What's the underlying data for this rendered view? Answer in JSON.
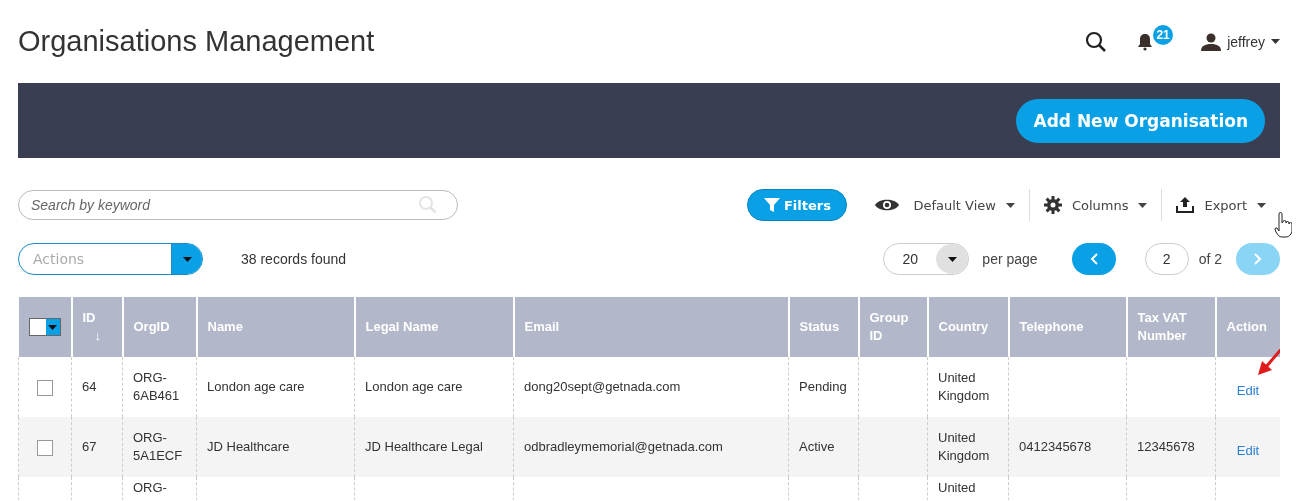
{
  "header": {
    "title": "Organisations Management",
    "notifications": "21",
    "user": "jeffrey"
  },
  "banner": {
    "button": "Add New Organisation"
  },
  "search": {
    "placeholder": "Search by keyword"
  },
  "toolbar": {
    "filters": "Filters",
    "view": "Default View",
    "columns": "Columns",
    "export": "Export"
  },
  "actions": {
    "placeholder": "Actions"
  },
  "records": "38 records found",
  "pagination": {
    "per_page_value": "20",
    "per_page_label": "per page",
    "page": "2",
    "of": "of 2",
    "prev_disabled": false,
    "next_disabled": true
  },
  "table": {
    "select_all_checked": false,
    "columns": [
      {
        "label": "ID",
        "sort_icon": "↓"
      },
      {
        "label": "OrgID"
      },
      {
        "label": "Name"
      },
      {
        "label": "Legal Name"
      },
      {
        "label": "Email"
      },
      {
        "label": "Status"
      },
      {
        "label": "Group ID"
      },
      {
        "label": "Country"
      },
      {
        "label": "Telephone"
      },
      {
        "label": "Tax VAT Number"
      },
      {
        "label": "Action"
      }
    ],
    "rows": [
      {
        "checked": false,
        "id": "64",
        "org_id": "ORG-6AB461",
        "name": "London age care",
        "legal_name": "London age care",
        "email": "dong20sept@getnada.com",
        "status": "Pending",
        "country": "United Kingdom",
        "action": "Edit"
      },
      {
        "checked": false,
        "id": "67",
        "org_id": "ORG-5A1ECF",
        "name": "JD Healthcare",
        "legal_name": "JD Healthcare Legal",
        "email": "odbradleymemorial@getnada.com",
        "status": "Active",
        "country": "United Kingdom",
        "telephone": "0412345678",
        "tax_vat_number": "12345678",
        "action": "Edit"
      },
      {
        "org_id": "ORG-",
        "country": "United"
      }
    ]
  }
}
